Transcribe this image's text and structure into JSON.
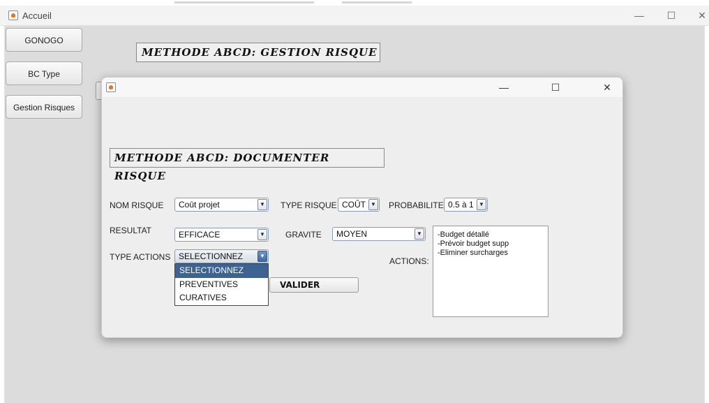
{
  "outer_window": {
    "title": "Accueil",
    "controls": {
      "minimize": "—",
      "maximize": "☐",
      "close": "✕"
    }
  },
  "sidebar": {
    "buttons": [
      {
        "label": "GONOGO"
      },
      {
        "label": "BC Type"
      },
      {
        "label": "Gestion Risques"
      }
    ]
  },
  "outer_heading": "METHODE ABCD: GESTION RISQUE",
  "dialog": {
    "controls": {
      "minimize": "—",
      "maximize": "☐",
      "close": "✕"
    },
    "heading": "METHODE ABCD: DOCUMENTER RISQUE",
    "nom_risque": {
      "label": "NOM RISQUE",
      "value": "Coût projet"
    },
    "type_risque": {
      "label": "TYPE RISQUE",
      "value": "COÛT"
    },
    "probabilite": {
      "label": "PROBABILITE",
      "value": "0.5 à 1"
    },
    "resultat": {
      "label": "RESULTAT",
      "value": "EFFICACE"
    },
    "gravite": {
      "label": "GRAVITE",
      "value": "MOYEN"
    },
    "type_actions": {
      "label": "TYPE ACTIONS",
      "value": "SELECTIONNEZ",
      "options": [
        "SELECTIONNEZ",
        "PREVENTIVES",
        "CURATIVES"
      ]
    },
    "actions": {
      "label": "ACTIONS:",
      "lines": [
        "-Budget détallé",
        "-Prévoir budget supp",
        "-Eliminer surcharges"
      ]
    },
    "valider_label": "VALIDER"
  }
}
